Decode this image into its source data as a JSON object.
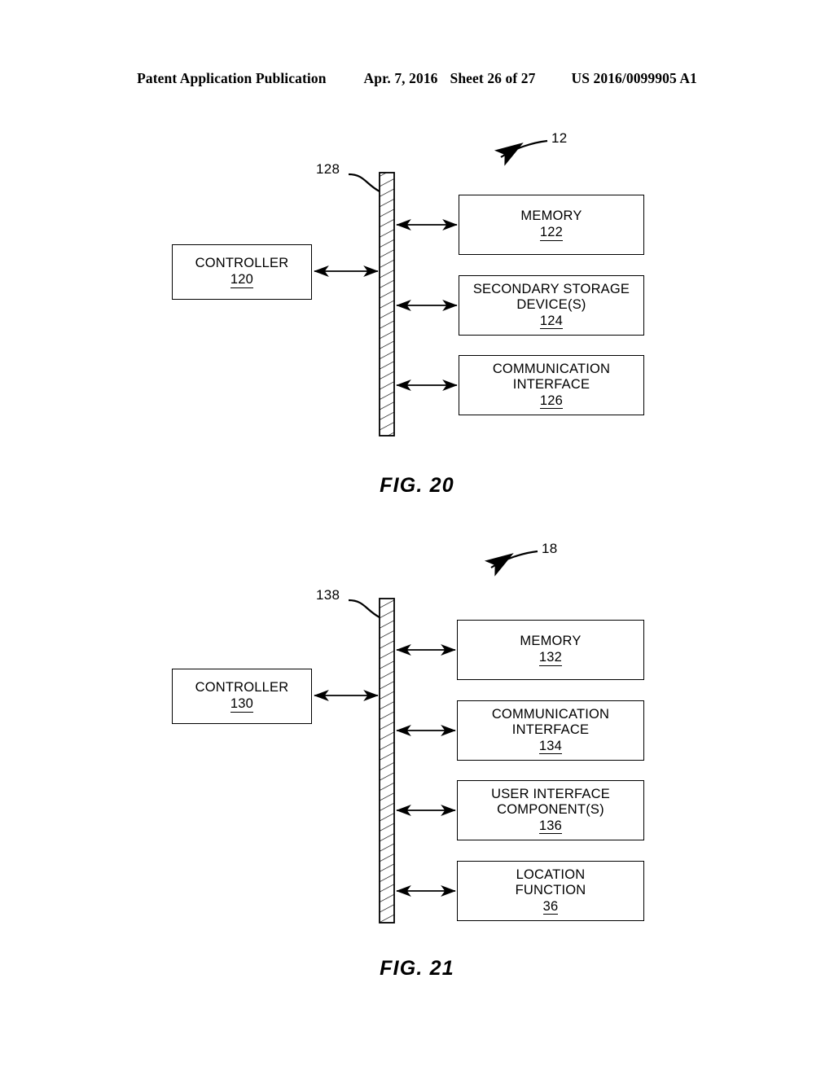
{
  "header": {
    "publication": "Patent Application Publication",
    "date": "Apr. 7, 2016",
    "sheet": "Sheet 26 of 27",
    "patent_number": "US 2016/0099905 A1"
  },
  "figure_20": {
    "caption": "FIG. 20",
    "system_ref": "12",
    "bus_ref": "128",
    "controller": {
      "label": "CONTROLLER",
      "ref": "120"
    },
    "blocks": [
      {
        "label": "MEMORY",
        "ref": "122"
      },
      {
        "label": "SECONDARY STORAGE\nDEVICE(S)",
        "ref": "124"
      },
      {
        "label": "COMMUNICATION\nINTERFACE",
        "ref": "126"
      }
    ]
  },
  "figure_21": {
    "caption": "FIG. 21",
    "system_ref": "18",
    "bus_ref": "138",
    "controller": {
      "label": "CONTROLLER",
      "ref": "130"
    },
    "blocks": [
      {
        "label": "MEMORY",
        "ref": "132"
      },
      {
        "label": "COMMUNICATION\nINTERFACE",
        "ref": "134"
      },
      {
        "label": "USER INTERFACE\nCOMPONENT(S)",
        "ref": "136"
      },
      {
        "label": "LOCATION\nFUNCTION",
        "ref": "36"
      }
    ]
  },
  "style": {
    "ink": "#000000",
    "paper": "#ffffff"
  }
}
